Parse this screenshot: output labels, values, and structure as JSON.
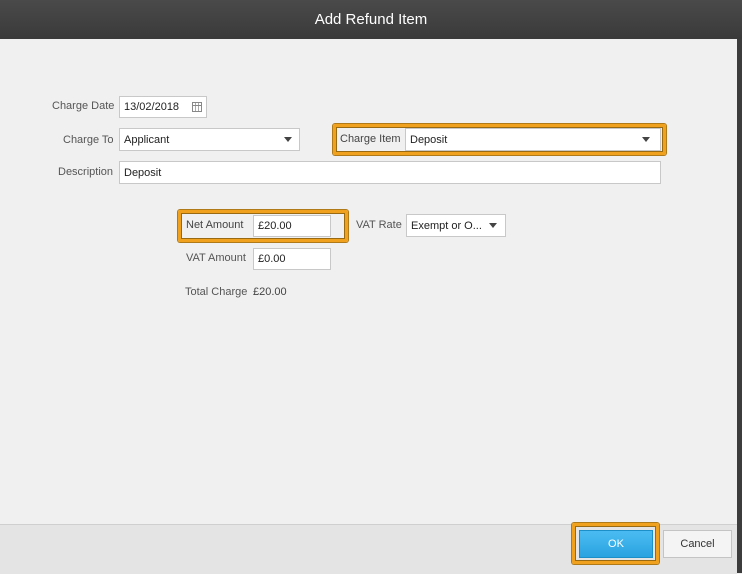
{
  "dialog": {
    "title": "Add Refund Item"
  },
  "form": {
    "charge_date": {
      "label": "Charge Date",
      "value": "13/02/2018"
    },
    "charge_to": {
      "label": "Charge To",
      "value": "Applicant"
    },
    "charge_item": {
      "label": "Charge Item",
      "value": "Deposit"
    },
    "description": {
      "label": "Description",
      "value": "Deposit"
    },
    "net_amount": {
      "label": "Net Amount",
      "value": "£20.00"
    },
    "vat_rate": {
      "label": "VAT Rate",
      "value": "Exempt or O..."
    },
    "vat_amount": {
      "label": "VAT Amount",
      "value": "£0.00"
    },
    "total_charge": {
      "label": "Total Charge",
      "value": "£20.00"
    }
  },
  "footer": {
    "ok_label": "OK",
    "cancel_label": "Cancel"
  },
  "colors": {
    "highlight": "#f0a11d",
    "ok_button": "#3aaee8",
    "titlebar": "#404040"
  }
}
